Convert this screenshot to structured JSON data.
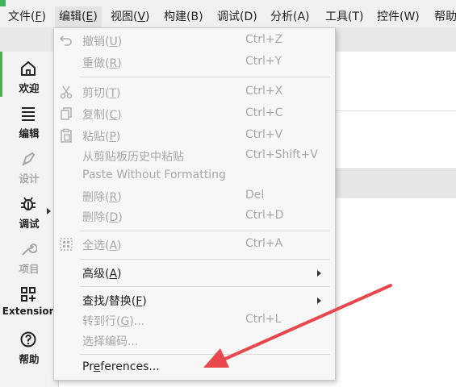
{
  "menubar": {
    "items": [
      {
        "text": "文件(F)",
        "pre": "文件(",
        "u": "F",
        "post": ")"
      },
      {
        "text": "编辑(E)",
        "pre": "编辑(",
        "u": "E",
        "post": ")"
      },
      {
        "text": "视图(V)",
        "pre": "视图(",
        "u": "V",
        "post": ")"
      },
      {
        "text": "构建(B)"
      },
      {
        "text": "调试(D)"
      },
      {
        "text": "分析(A)"
      },
      {
        "text": "工具(T)"
      },
      {
        "text": "控件(W)"
      },
      {
        "text": "帮助"
      }
    ]
  },
  "sidebar": {
    "items": [
      {
        "label": "欢迎",
        "icon": "home-icon"
      },
      {
        "label": "编辑",
        "icon": "lines-icon"
      },
      {
        "label": "设计",
        "icon": "pen-icon"
      },
      {
        "label": "调试",
        "icon": "bug-icon"
      },
      {
        "label": "项目",
        "icon": "wrench-icon"
      },
      {
        "label": "Extension",
        "icon": "extension-icon"
      },
      {
        "label": "帮助",
        "icon": "help-icon"
      }
    ]
  },
  "edit_menu": {
    "undo": {
      "pre": "撤销(",
      "u": "U",
      "post": ")",
      "shortcut": "Ctrl+Z"
    },
    "redo": {
      "pre": "重做(",
      "u": "R",
      "post": ")",
      "shortcut": "Ctrl+Y"
    },
    "cut": {
      "pre": "剪切(",
      "u": "T",
      "post": ")",
      "shortcut": "Ctrl+X"
    },
    "copy": {
      "pre": "复制(",
      "u": "C",
      "post": ")",
      "shortcut": "Ctrl+C"
    },
    "paste": {
      "pre": "粘贴(",
      "u": "P",
      "post": ")",
      "shortcut": "Ctrl+V"
    },
    "paste_history": {
      "label": "从剪贴板历史中粘贴",
      "shortcut": "Ctrl+Shift+V"
    },
    "paste_plain": {
      "label": "Paste Without Formatting"
    },
    "delete": {
      "pre": "删除(",
      "u": "R",
      "post": ")",
      "shortcut": "Del"
    },
    "delete2": {
      "pre": "删除(",
      "u": "D",
      "post": ")",
      "shortcut": "Ctrl+D"
    },
    "select_all": {
      "pre": "全选(",
      "u": "A",
      "post": ")",
      "shortcut": "Ctrl+A"
    },
    "advanced": {
      "pre": "高级(",
      "u": "A",
      "post": ")"
    },
    "find_replace": {
      "pre": "查找/替换(",
      "u": "F",
      "post": ")"
    },
    "goto_line": {
      "pre": "转到行(",
      "u": "G",
      "post": ")...",
      "shortcut": "Ctrl+L"
    },
    "encoding": {
      "label": "选择编码..."
    },
    "preferences": {
      "pre": "Pr",
      "u": "e",
      "post": "ferences..."
    }
  },
  "colors": {
    "accent": "#4caf50",
    "annotation_arrow": "#e8474c"
  }
}
